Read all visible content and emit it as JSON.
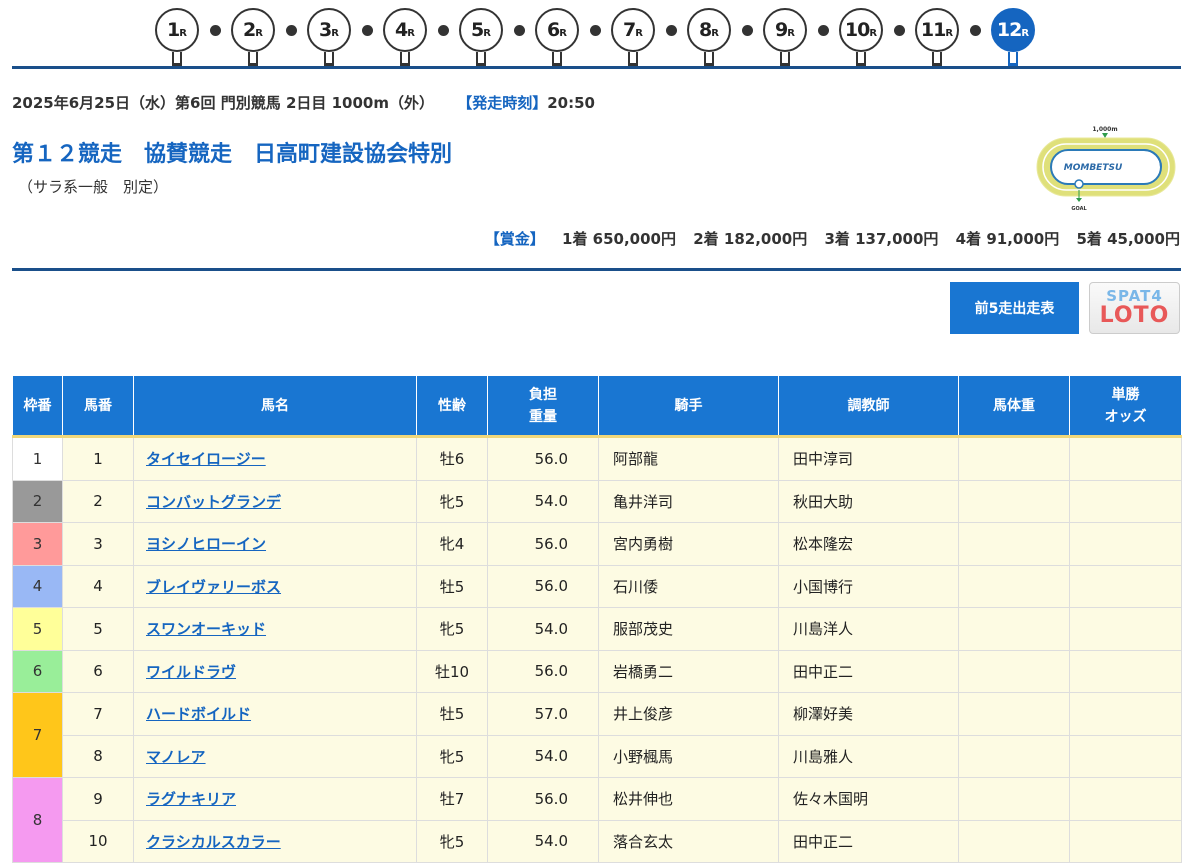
{
  "races": [
    {
      "num": "1",
      "suffix": "R",
      "active": false
    },
    {
      "num": "2",
      "suffix": "R",
      "active": false
    },
    {
      "num": "3",
      "suffix": "R",
      "active": false
    },
    {
      "num": "4",
      "suffix": "R",
      "active": false
    },
    {
      "num": "5",
      "suffix": "R",
      "active": false
    },
    {
      "num": "6",
      "suffix": "R",
      "active": false
    },
    {
      "num": "7",
      "suffix": "R",
      "active": false
    },
    {
      "num": "8",
      "suffix": "R",
      "active": false
    },
    {
      "num": "9",
      "suffix": "R",
      "active": false
    },
    {
      "num": "10",
      "suffix": "R",
      "active": false
    },
    {
      "num": "11",
      "suffix": "R",
      "active": false
    },
    {
      "num": "12",
      "suffix": "R",
      "active": true
    }
  ],
  "meta": {
    "info": "2025年6月25日（水）第6回 門別競馬 2日目 1000m（外）",
    "start_label": "【発走時刻】",
    "start_time": "20:50"
  },
  "race_title": "第１２競走　協賛競走　日高町建設協会特別",
  "race_subtitle": "（サラ系一般　別定）",
  "course_map": {
    "track": "MOMBETSU",
    "distance": "1,000m",
    "goal": "GOAL"
  },
  "prize": {
    "label": "【賞金】",
    "items": [
      "1着 650,000円",
      "2着 182,000円",
      "3着 137,000円",
      "4着 91,000円",
      "5着 45,000円"
    ]
  },
  "buttons": {
    "prev5": "前5走出走表",
    "spat_top": "SPAT4",
    "spat_bottom": "LOTO"
  },
  "table": {
    "headers": {
      "waku": "枠番",
      "umaban": "馬番",
      "name": "馬名",
      "sex_age": "性齢",
      "weight_1": "負担",
      "weight_2": "重量",
      "jockey": "騎手",
      "trainer": "調教師",
      "body": "馬体重",
      "odds_1": "単勝",
      "odds_2": "オッズ"
    },
    "rows": [
      {
        "waku": "1",
        "umaban": "1",
        "name": "タイセイロージー",
        "sex_age": "牡6",
        "weight": "56.0",
        "jockey": "阿部龍",
        "trainer": "田中淳司"
      },
      {
        "waku": "2",
        "umaban": "2",
        "name": "コンバットグランデ",
        "sex_age": "牝5",
        "weight": "54.0",
        "jockey": "亀井洋司",
        "trainer": "秋田大助"
      },
      {
        "waku": "3",
        "umaban": "3",
        "name": "ヨシノヒローイン",
        "sex_age": "牝4",
        "weight": "56.0",
        "jockey": "宮内勇樹",
        "trainer": "松本隆宏"
      },
      {
        "waku": "4",
        "umaban": "4",
        "name": "ブレイヴァリーボス",
        "sex_age": "牡5",
        "weight": "56.0",
        "jockey": "石川倭",
        "trainer": "小国博行"
      },
      {
        "waku": "5",
        "umaban": "5",
        "name": "スワンオーキッド",
        "sex_age": "牝5",
        "weight": "54.0",
        "jockey": "服部茂史",
        "trainer": "川島洋人"
      },
      {
        "waku": "6",
        "umaban": "6",
        "name": "ワイルドラヴ",
        "sex_age": "牡10",
        "weight": "56.0",
        "jockey": "岩橋勇二",
        "trainer": "田中正二"
      },
      {
        "waku": "7",
        "umaban": "7",
        "name": "ハードボイルド",
        "sex_age": "牡5",
        "weight": "57.0",
        "jockey": "井上俊彦",
        "trainer": "柳澤好美"
      },
      {
        "waku": "7",
        "umaban": "8",
        "name": "マノレア",
        "sex_age": "牝5",
        "weight": "54.0",
        "jockey": "小野楓馬",
        "trainer": "川島雅人"
      },
      {
        "waku": "8",
        "umaban": "9",
        "name": "ラグナキリア",
        "sex_age": "牡7",
        "weight": "56.0",
        "jockey": "松井伸也",
        "trainer": "佐々木国明"
      },
      {
        "waku": "8",
        "umaban": "10",
        "name": "クラシカルスカラー",
        "sex_age": "牝5",
        "weight": "54.0",
        "jockey": "落合玄太",
        "trainer": "田中正二"
      }
    ]
  },
  "colors": {
    "waku_1": "#ffffff",
    "waku_2": "#999999",
    "waku_3": "#ff9a9a",
    "waku_4": "#99b8f5",
    "waku_5": "#ffff99",
    "waku_6": "#99ee99",
    "waku_7": "#ffc61a",
    "waku_8": "#f59af0",
    "accent": "#1565c0"
  }
}
